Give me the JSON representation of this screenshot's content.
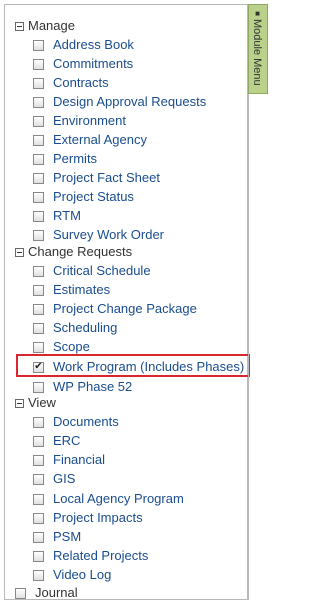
{
  "module_tab": {
    "label": "Module Menu",
    "pin_icon": "pin-icon"
  },
  "groups": [
    {
      "label": "Manage",
      "items": [
        {
          "label": "Address Book",
          "checked": false
        },
        {
          "label": "Commitments",
          "checked": false
        },
        {
          "label": "Contracts",
          "checked": false
        },
        {
          "label": "Design Approval Requests",
          "checked": false
        },
        {
          "label": "Environment",
          "checked": false
        },
        {
          "label": "External Agency",
          "checked": false
        },
        {
          "label": "Permits",
          "checked": false
        },
        {
          "label": "Project Fact Sheet",
          "checked": false
        },
        {
          "label": "Project Status",
          "checked": false
        },
        {
          "label": "RTM",
          "checked": false
        },
        {
          "label": "Survey Work Order",
          "checked": false
        }
      ]
    },
    {
      "label": "Change Requests",
      "items": [
        {
          "label": "Critical Schedule",
          "checked": false
        },
        {
          "label": "Estimates",
          "checked": false
        },
        {
          "label": "Project Change Package",
          "checked": false
        },
        {
          "label": "Scheduling",
          "checked": false
        },
        {
          "label": "Scope",
          "checked": false
        },
        {
          "label": "Work Program (Includes Phases)",
          "checked": true
        },
        {
          "label": "WP Phase 52",
          "checked": false
        }
      ]
    },
    {
      "label": "View",
      "items": [
        {
          "label": "Documents",
          "checked": false
        },
        {
          "label": "ERC",
          "checked": false
        },
        {
          "label": "Financial",
          "checked": false
        },
        {
          "label": "GIS",
          "checked": false
        },
        {
          "label": "Local Agency Program",
          "checked": false
        },
        {
          "label": "Project Impacts",
          "checked": false
        },
        {
          "label": "PSM",
          "checked": false
        },
        {
          "label": "Related Projects",
          "checked": false
        },
        {
          "label": "Video Log",
          "checked": false
        }
      ]
    }
  ],
  "journal": {
    "label": "Journal",
    "checked": false
  },
  "colors": {
    "link": "#1a4d8f",
    "module_tab_bg": "#b9d18b",
    "highlight_border": "#d9272e"
  }
}
